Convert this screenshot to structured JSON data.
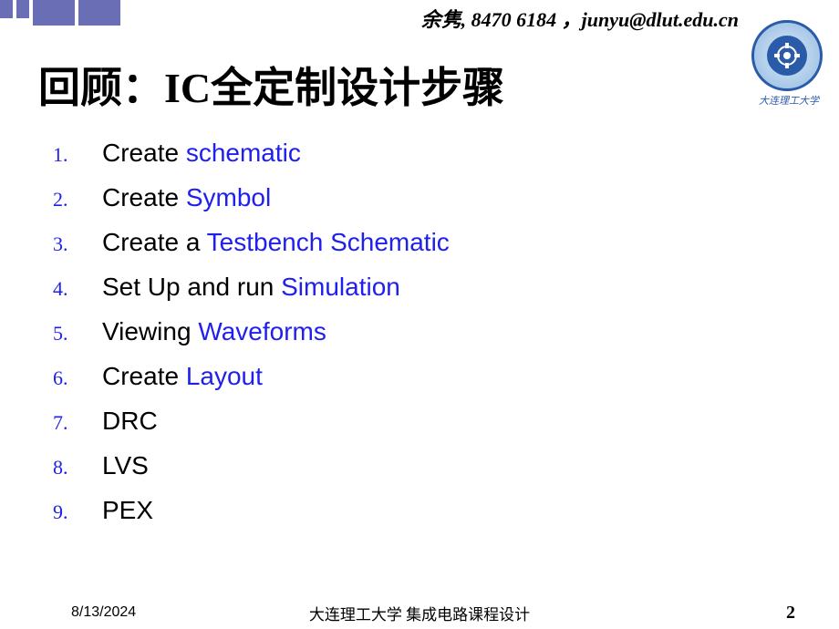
{
  "contact": "余隽, 8470 6184 ，junyu@dlut.edu.cn",
  "logo_caption": "大连理工大学",
  "title_prefix": "回顾：",
  "title_ic": "IC",
  "title_suffix": "全定制设计步骤",
  "items": [
    {
      "num": "1.",
      "parts": [
        {
          "t": "Create ",
          "c": "black"
        },
        {
          "t": "schematic",
          "c": "blue"
        }
      ]
    },
    {
      "num": "2.",
      "parts": [
        {
          "t": "Create ",
          "c": "black"
        },
        {
          "t": "Symbol",
          "c": "blue"
        }
      ]
    },
    {
      "num": "3.",
      "parts": [
        {
          "t": "Create a ",
          "c": "black"
        },
        {
          "t": "Testbench Schematic",
          "c": "blue"
        }
      ]
    },
    {
      "num": "4.",
      "parts": [
        {
          "t": "Set Up and run ",
          "c": "black"
        },
        {
          "t": "Simulation",
          "c": "blue"
        }
      ]
    },
    {
      "num": "5.",
      "parts": [
        {
          "t": "Viewing ",
          "c": "black"
        },
        {
          "t": "Waveforms",
          "c": "blue"
        }
      ]
    },
    {
      "num": "6.",
      "parts": [
        {
          "t": "Create ",
          "c": "black"
        },
        {
          "t": "Layout",
          "c": "blue"
        }
      ]
    },
    {
      "num": "7.",
      "parts": [
        {
          "t": "DRC",
          "c": "black"
        }
      ]
    },
    {
      "num": "8.",
      "parts": [
        {
          "t": "LVS",
          "c": "black"
        }
      ]
    },
    {
      "num": "9.",
      "parts": [
        {
          "t": "PEX",
          "c": "black"
        }
      ]
    }
  ],
  "footer": {
    "date": "8/13/2024",
    "center": "大连理工大学 集成电路课程设计",
    "page": "2"
  }
}
